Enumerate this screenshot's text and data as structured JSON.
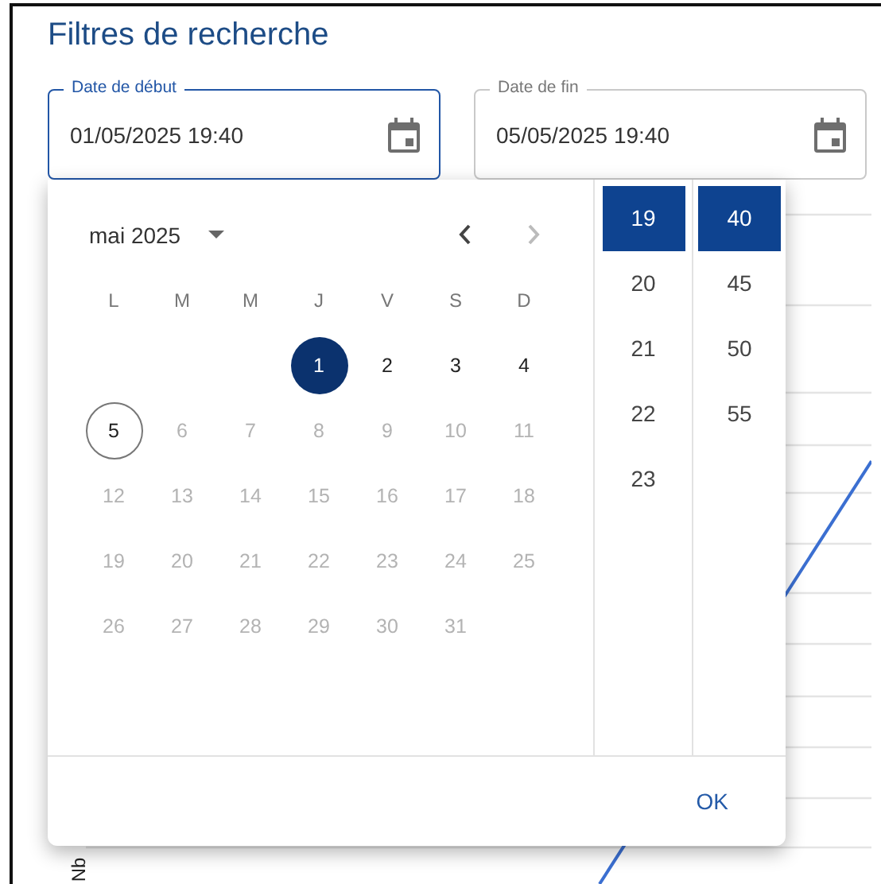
{
  "title": "Filtres de recherche",
  "fields": [
    {
      "label": "Date de début",
      "value": "01/05/2025 19:40",
      "focused": true
    },
    {
      "label": "Date de fin",
      "value": "05/05/2025 19:40",
      "focused": false
    }
  ],
  "chart": {
    "ylabel": "Nb"
  },
  "picker": {
    "month": "mai 2025",
    "weekdays": [
      "L",
      "M",
      "M",
      "J",
      "V",
      "S",
      "D"
    ],
    "weeks": [
      {
        "days": [
          {
            "label": "1",
            "selected": true,
            "today": false,
            "disabled": false
          },
          {
            "label": "2",
            "selected": false,
            "today": false,
            "disabled": false
          },
          {
            "label": "3",
            "selected": false,
            "today": false,
            "disabled": false
          },
          {
            "label": "4",
            "selected": false,
            "today": false,
            "disabled": false
          }
        ]
      },
      {
        "days": [
          {
            "label": "5",
            "selected": false,
            "today": true,
            "disabled": false
          },
          {
            "label": "6",
            "selected": false,
            "today": false,
            "disabled": true
          },
          {
            "label": "7",
            "selected": false,
            "today": false,
            "disabled": true
          },
          {
            "label": "8",
            "selected": false,
            "today": false,
            "disabled": true
          },
          {
            "label": "9",
            "selected": false,
            "today": false,
            "disabled": true
          },
          {
            "label": "10",
            "selected": false,
            "today": false,
            "disabled": true
          },
          {
            "label": "11",
            "selected": false,
            "today": false,
            "disabled": true
          }
        ]
      },
      {
        "days": [
          {
            "label": "12",
            "selected": false,
            "today": false,
            "disabled": true
          },
          {
            "label": "13",
            "selected": false,
            "today": false,
            "disabled": true
          },
          {
            "label": "14",
            "selected": false,
            "today": false,
            "disabled": true
          },
          {
            "label": "15",
            "selected": false,
            "today": false,
            "disabled": true
          },
          {
            "label": "16",
            "selected": false,
            "today": false,
            "disabled": true
          },
          {
            "label": "17",
            "selected": false,
            "today": false,
            "disabled": true
          },
          {
            "label": "18",
            "selected": false,
            "today": false,
            "disabled": true
          }
        ]
      },
      {
        "days": [
          {
            "label": "19",
            "selected": false,
            "today": false,
            "disabled": true
          },
          {
            "label": "20",
            "selected": false,
            "today": false,
            "disabled": true
          },
          {
            "label": "21",
            "selected": false,
            "today": false,
            "disabled": true
          },
          {
            "label": "22",
            "selected": false,
            "today": false,
            "disabled": true
          },
          {
            "label": "23",
            "selected": false,
            "today": false,
            "disabled": true
          },
          {
            "label": "24",
            "selected": false,
            "today": false,
            "disabled": true
          },
          {
            "label": "25",
            "selected": false,
            "today": false,
            "disabled": true
          }
        ]
      },
      {
        "days": [
          {
            "label": "26",
            "selected": false,
            "today": false,
            "disabled": true
          },
          {
            "label": "27",
            "selected": false,
            "today": false,
            "disabled": true
          },
          {
            "label": "28",
            "selected": false,
            "today": false,
            "disabled": true
          },
          {
            "label": "29",
            "selected": false,
            "today": false,
            "disabled": true
          },
          {
            "label": "30",
            "selected": false,
            "today": false,
            "disabled": true
          },
          {
            "label": "31",
            "selected": false,
            "today": false,
            "disabled": true
          }
        ]
      }
    ],
    "hours": [
      {
        "label": "19",
        "selected": true
      },
      {
        "label": "20",
        "selected": false
      },
      {
        "label": "21",
        "selected": false
      },
      {
        "label": "22",
        "selected": false
      },
      {
        "label": "23",
        "selected": false
      }
    ],
    "minutes": [
      {
        "label": "40",
        "selected": true
      },
      {
        "label": "45",
        "selected": false
      },
      {
        "label": "50",
        "selected": false
      },
      {
        "label": "55",
        "selected": false
      }
    ],
    "ok_button": "OK"
  }
}
